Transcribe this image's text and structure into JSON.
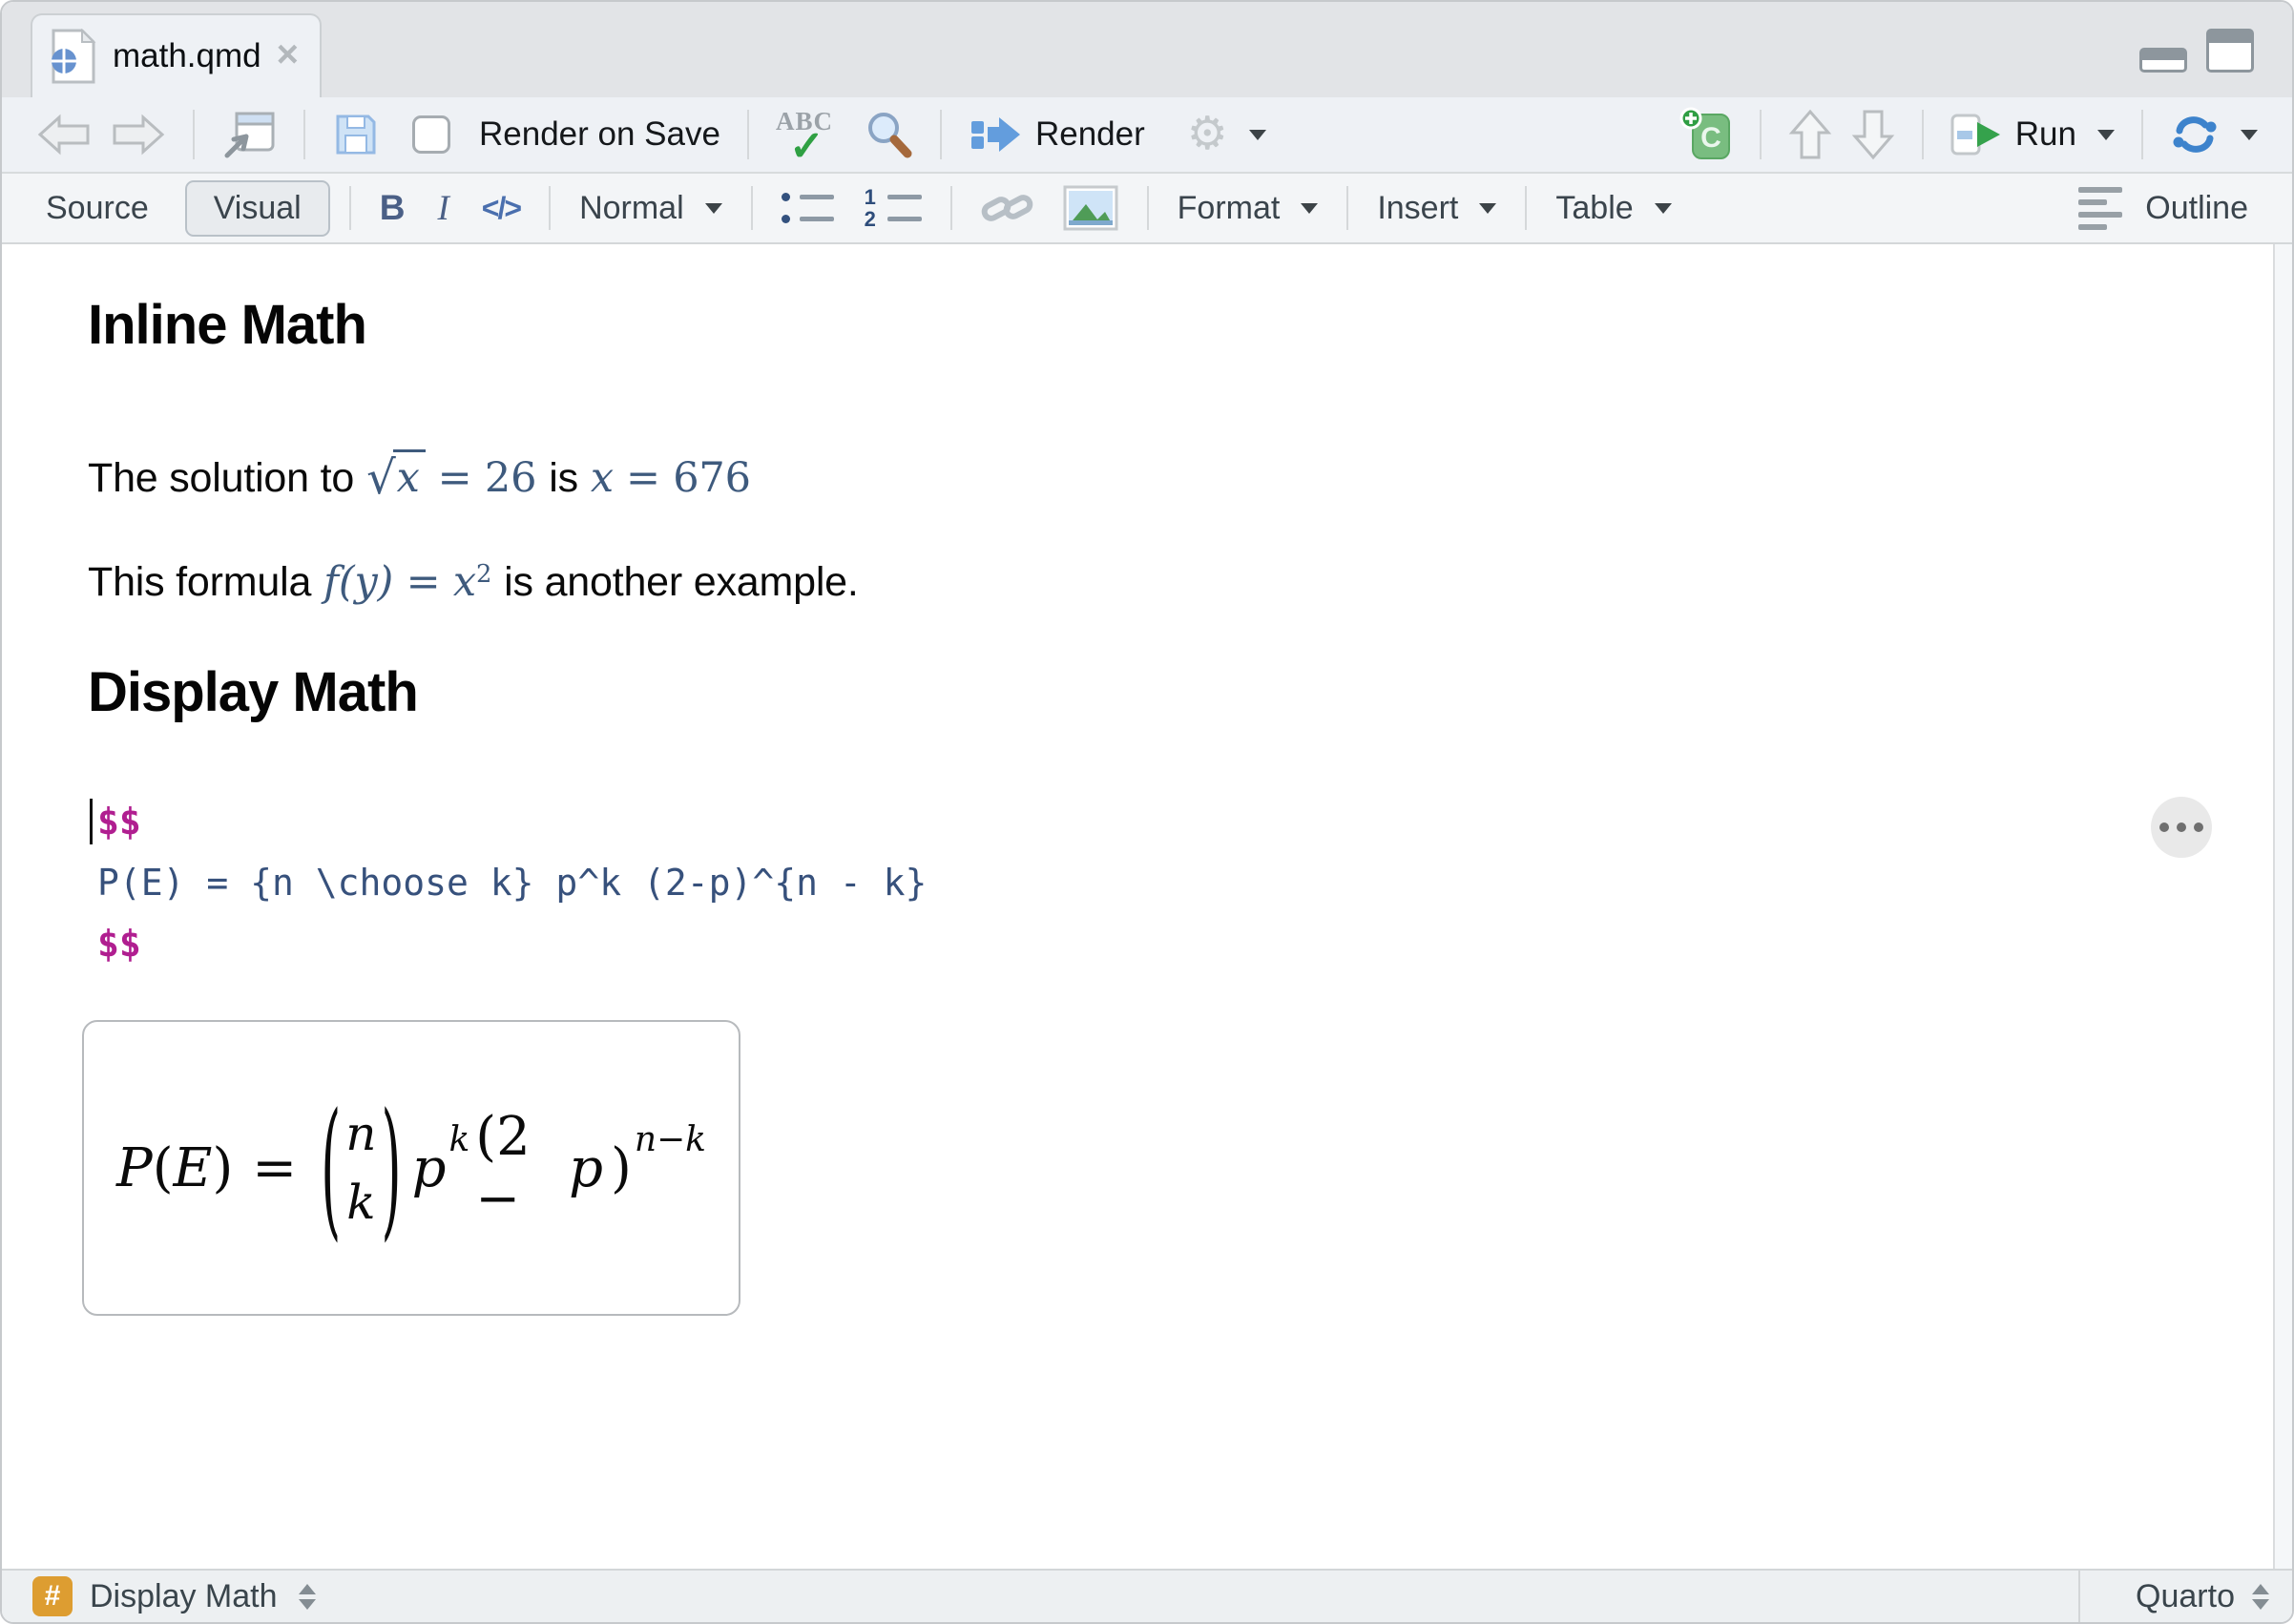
{
  "colors": {
    "math_blue": "#3e5a7d",
    "code_blue": "#37517c",
    "delimiter_magenta": "#b01e90",
    "badge_orange": "#dd9d31",
    "run_green": "#35a24c",
    "accent_blue": "#5b8fd4"
  },
  "icons": {
    "gear_glyph": "⚙",
    "close_glyph": "×",
    "check_glyph": "✓",
    "spellcheck_text": "ABC"
  },
  "tab": {
    "title": "math.qmd"
  },
  "toolbar_main": {
    "render_on_save_label": "Render on Save",
    "render_label": "Render",
    "run_label": "Run",
    "chunk_letter": "C"
  },
  "toolbar_format": {
    "source_label": "Source",
    "visual_label": "Visual",
    "bold_label": "B",
    "italic_label": "I",
    "code_label": "</>",
    "style_label": "Normal",
    "ol_num1": "1",
    "ol_num2": "2",
    "format_label": "Format",
    "insert_label": "Insert",
    "table_label": "Table",
    "outline_label": "Outline"
  },
  "content": {
    "heading_inline": "Inline Math",
    "heading_display": "Display Math",
    "para1": {
      "text1": "The solution to",
      "radical": "√",
      "radicand": "x",
      "math1_rest": "= 26",
      "text2": "is",
      "math2_var": "x",
      "math2_rest": "= 676"
    },
    "para2": {
      "text1": "This formula",
      "math_body": "f(y) = x",
      "math_sup": "2",
      "text2": "is another example."
    },
    "code": {
      "open_delim": "$$",
      "line": "P(E) = {n \\choose k} p^k (2-p)^{n - k}",
      "close_delim": "$$"
    },
    "preview": {
      "P": "P",
      "open": "(",
      "E": "E",
      "close": ")",
      "equals": "=",
      "paren_open": "(",
      "binom_top": "n",
      "binom_bottom": "k",
      "paren_close": ")",
      "p_var": "p",
      "p_sup": "k",
      "group_pre": "(2 −",
      "group_p": "p",
      "group_close": ")",
      "group_sup": "n−k"
    }
  },
  "status": {
    "section_icon": "#",
    "section_label": "Display Math",
    "mode_label": "Quarto"
  }
}
